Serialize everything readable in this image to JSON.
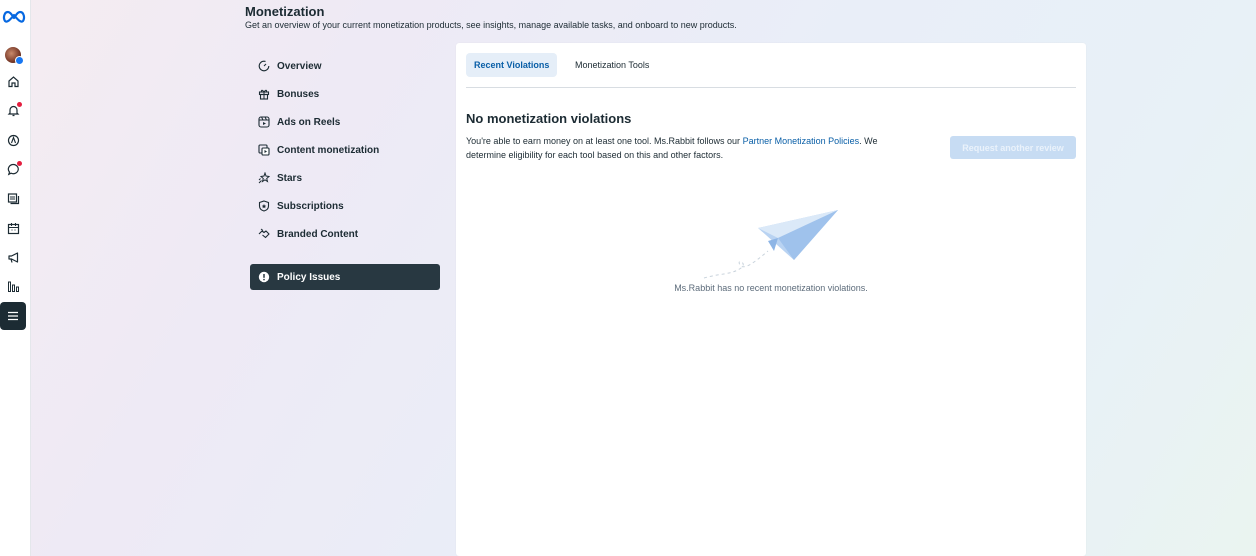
{
  "rail": {
    "items": [
      {
        "name": "meta-logo-icon"
      },
      {
        "name": "profile-avatar"
      },
      {
        "name": "home-icon"
      },
      {
        "name": "notifications-icon"
      },
      {
        "name": "compass-icon"
      },
      {
        "name": "messages-icon"
      },
      {
        "name": "posts-icon"
      },
      {
        "name": "calendar-icon"
      },
      {
        "name": "ads-megaphone-icon"
      },
      {
        "name": "insights-icon"
      },
      {
        "name": "menu-icon"
      }
    ],
    "badge_color": "#e41e3f"
  },
  "header": {
    "title": "Monetization",
    "subtitle": "Get an overview of your current monetization products, see insights, manage available tasks, and onboard to new products."
  },
  "sidenav": {
    "items": [
      {
        "label": "Overview",
        "icon": "dashboard-icon"
      },
      {
        "label": "Bonuses",
        "icon": "gift-icon"
      },
      {
        "label": "Ads on Reels",
        "icon": "reels-icon"
      },
      {
        "label": "Content monetization",
        "icon": "content-icon"
      },
      {
        "label": "Stars",
        "icon": "stars-icon"
      },
      {
        "label": "Subscriptions",
        "icon": "shield-icon"
      },
      {
        "label": "Branded Content",
        "icon": "handshake-icon"
      }
    ],
    "active": {
      "label": "Policy Issues",
      "icon": "alert-icon"
    }
  },
  "main": {
    "tabs": [
      {
        "label": "Recent Violations",
        "active": true
      },
      {
        "label": "Monetization Tools",
        "active": false
      }
    ],
    "title": "No monetization violations",
    "desc_part1": "You're able to earn money on at least one tool. Ms.Rabbit follows our ",
    "desc_link": "Partner Monetization Policies",
    "desc_part2": ". We determine eligibility for each tool based on this and other factors.",
    "review_button": "Request another review",
    "empty_message": "Ms.Rabbit has no recent monetization violations."
  },
  "colors": {
    "accent": "#0a5fa7",
    "active_nav_bg": "#283841",
    "disabled_button_bg": "#c7dcf3"
  }
}
